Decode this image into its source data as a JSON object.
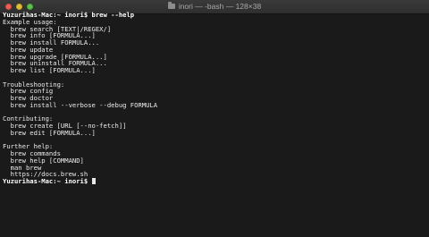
{
  "window": {
    "title": "inori — -bash — 128×38"
  },
  "terminal": {
    "lines": [
      "Yuzurihas-Mac:~ inori$ brew --help",
      "Example usage:",
      "  brew search [TEXT|/REGEX/]",
      "  brew info [FORMULA...]",
      "  brew install FORMULA...",
      "  brew update",
      "  brew upgrade [FORMULA...]",
      "  brew uninstall FORMULA...",
      "  brew list [FORMULA...]",
      "",
      "Troubleshooting:",
      "  brew config",
      "  brew doctor",
      "  brew install --verbose --debug FORMULA",
      "",
      "Contributing:",
      "  brew create [URL [--no-fetch]]",
      "  brew edit [FORMULA...]",
      "",
      "Further help:",
      "  brew commands",
      "  brew help [COMMAND]",
      "  man brew",
      "  https://docs.brew.sh"
    ],
    "prompt": "Yuzurihas-Mac:~ inori$ "
  }
}
